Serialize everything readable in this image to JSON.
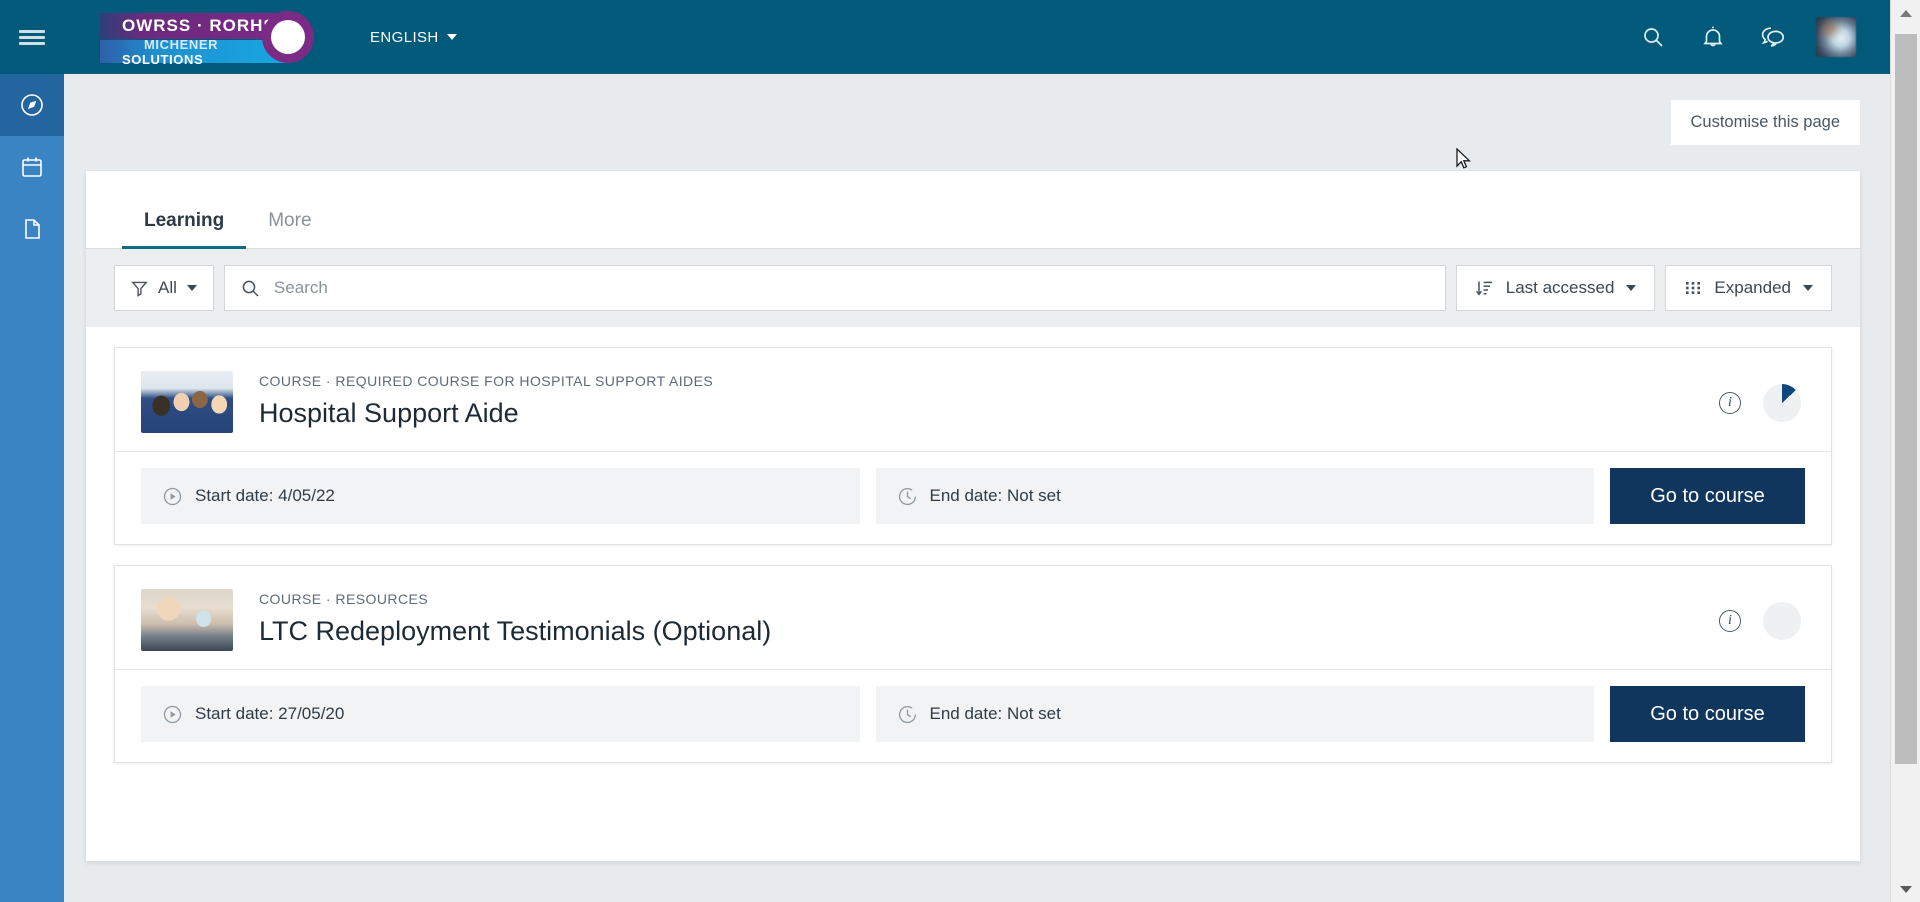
{
  "header": {
    "menu_toggle": "menu-toggle",
    "logo_top_text": "OWRSS · RORHSA",
    "logo_bottom_prefix": "MICHENER ",
    "logo_bottom_emphasis": "SOLUTIONS",
    "language": "ENGLISH",
    "icons": [
      "search-icon",
      "bell-icon",
      "messages-icon"
    ],
    "avatar_label": "user-avatar",
    "background_color": "#015a7a"
  },
  "sidebar": {
    "background_color": "#3a84c3",
    "active_color": "#22659f",
    "items": [
      {
        "name": "compass-icon",
        "label": "Dashboard",
        "active": true
      },
      {
        "name": "calendar-icon",
        "label": "Calendar",
        "active": false
      },
      {
        "name": "file-icon",
        "label": "Private files",
        "active": false
      }
    ]
  },
  "page": {
    "customise_button": "Customise this page",
    "background_color": "#e8ebed"
  },
  "tabs": [
    {
      "label": "Learning",
      "active": true
    },
    {
      "label": "More",
      "active": false
    }
  ],
  "toolbar": {
    "filter_label": "All",
    "filter_icon": "funnel-icon",
    "search_placeholder": "Search",
    "search_value": "",
    "search_icon": "search-icon",
    "sort_label": "Last accessed",
    "sort_icon": "sort-amount-down-icon",
    "view_label": "Expanded",
    "view_icon": "grid-dots-icon"
  },
  "courses": [
    {
      "kicker": "COURSE · REQUIRED COURSE FOR HOSPITAL SUPPORT AIDES",
      "title": "Hospital Support Aide",
      "thumb_class": "t1",
      "thumb_alt": "Group of healthcare workers in blue scrubs",
      "info_icon": "info-icon",
      "progress_percent": 13,
      "progress_color": "#11457e",
      "progress_track": "#eef0f2",
      "start_date": "Start date: 4/05/22",
      "start_icon": "play-circle-icon",
      "end_date": "End date: Not set",
      "end_icon": "clock-icon",
      "action_label": "Go to course"
    },
    {
      "kicker": "COURSE · RESOURCES",
      "title": "LTC Redeployment Testimonials (Optional)",
      "thumb_class": "t2",
      "thumb_alt": "Patient in wheelchair with masked caregiver",
      "info_icon": "info-icon",
      "progress_percent": 0,
      "progress_color": "#11457e",
      "progress_track": "#eef0f2",
      "start_date": "Start date: 27/05/20",
      "start_icon": "play-circle-icon",
      "end_date": "End date: Not set",
      "end_icon": "clock-icon",
      "action_label": "Go to course"
    }
  ],
  "scrollbar": {
    "up_arrow": "scroll-up-arrow",
    "down_arrow": "scroll-down-arrow",
    "thumb": "scroll-thumb"
  },
  "colors": {
    "brand_teal": "#015a7a",
    "accent_navy": "#11365e",
    "tab_underline": "#0f6a86"
  }
}
